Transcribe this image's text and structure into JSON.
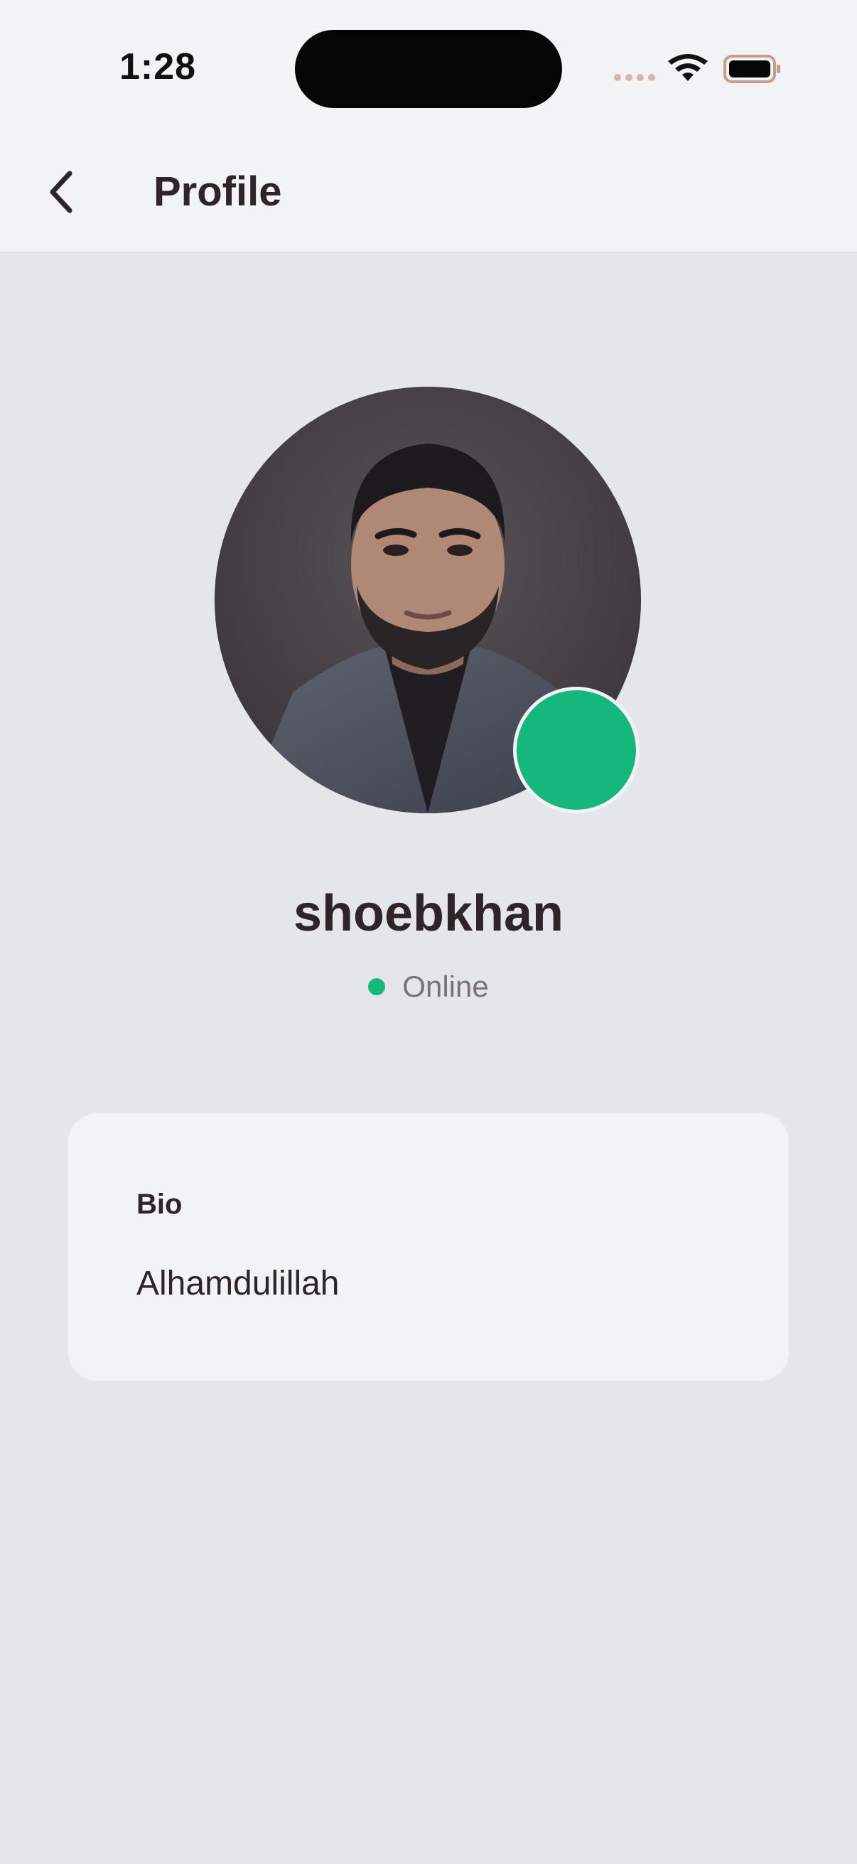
{
  "status_bar": {
    "time": "1:28"
  },
  "header": {
    "title": "Profile",
    "back_icon": "chevron-left-icon"
  },
  "profile": {
    "username": "shoebkhan",
    "status": "Online",
    "status_color": "#14b87d"
  },
  "bio": {
    "label": "Bio",
    "text": "Alhamdulillah"
  },
  "colors": {
    "background": "#e5e6ea",
    "surface": "#f2f3f5",
    "text_primary": "#2d2528",
    "text_secondary": "#76717a",
    "online_green": "#14b87d"
  }
}
